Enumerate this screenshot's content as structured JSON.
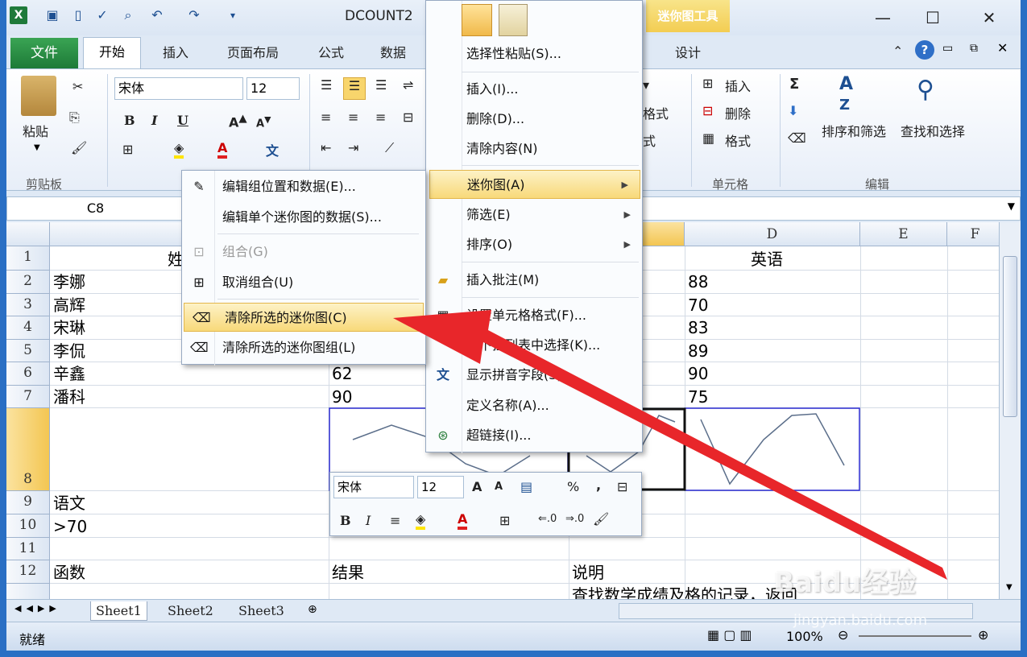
{
  "titlebar": {
    "title": "DCOUNT2",
    "context_tab": "迷你图工具"
  },
  "tabs": {
    "file": "文件",
    "home": "开始",
    "insert": "插入",
    "layout": "页面布局",
    "formula": "公式",
    "data": "数据",
    "design": "设计"
  },
  "ribbon": {
    "paste": "粘贴",
    "clipboard": "剪贴板",
    "font_name": "宋体",
    "font_size": "12",
    "bold": "B",
    "italic": "I",
    "underline": "U",
    "insert": "插入",
    "delete": "删除",
    "format": "格式",
    "cells_group": "单元格",
    "sort_filter": "排序和筛选",
    "find_select": "查找和选择",
    "edit_group": "编辑",
    "partial_format1": "格式",
    "partial_format2": "式"
  },
  "namebox": "C8",
  "columns": {
    "a": "",
    "b": "",
    "c": "",
    "d": "D",
    "e": "E",
    "f": "F"
  },
  "header_row": {
    "b_partial": "姓",
    "d": "英语"
  },
  "rows": [
    {
      "n": "1"
    },
    {
      "n": "2"
    },
    {
      "n": "3"
    },
    {
      "n": "4"
    },
    {
      "n": "5"
    },
    {
      "n": "6"
    },
    {
      "n": "7"
    },
    {
      "n": "8"
    },
    {
      "n": "9"
    },
    {
      "n": "10"
    },
    {
      "n": "11"
    },
    {
      "n": "12"
    }
  ],
  "names": [
    "李娜",
    "高辉",
    "宋琳",
    "李侃",
    "辛鑫",
    "潘科"
  ],
  "english": [
    "88",
    "70",
    "83",
    "89",
    "90",
    "75"
  ],
  "col_b_values": {
    "r6": "62",
    "r7": "90"
  },
  "row9": "语文",
  "row10": ">70",
  "row12": {
    "a": "函数",
    "b": "结果",
    "c": "说明"
  },
  "row13_c": "查找数学成绩及格的记录，返回",
  "sheets": [
    "Sheet1",
    "Sheet2",
    "Sheet3"
  ],
  "status": {
    "ready": "就绪",
    "zoom": "100%"
  },
  "submenu": [
    {
      "label": "编辑组位置和数据(E)...",
      "icon": "edit-sparkline-group-icon",
      "state": "normal"
    },
    {
      "label": "编辑单个迷你图的数据(S)...",
      "icon": "",
      "state": "normal"
    },
    {
      "label": "组合(G)",
      "icon": "group-icon",
      "state": "disabled"
    },
    {
      "label": "取消组合(U)",
      "icon": "ungroup-icon",
      "state": "normal"
    },
    {
      "label": "清除所选的迷你图(C)",
      "icon": "eraser-icon",
      "state": "highlighted"
    },
    {
      "label": "清除所选的迷你图组(L)",
      "icon": "eraser-icon",
      "state": "normal"
    }
  ],
  "context_menu": [
    {
      "label": "选择性粘贴(S)...",
      "arrow": false
    },
    {
      "label": "插入(I)...",
      "arrow": false
    },
    {
      "label": "删除(D)...",
      "arrow": false
    },
    {
      "label": "清除内容(N)",
      "arrow": false
    },
    {
      "label": "迷你图(A)",
      "arrow": true,
      "highlight": true
    },
    {
      "label": "筛选(E)",
      "arrow": true
    },
    {
      "label": "排序(O)",
      "arrow": true
    },
    {
      "label": "插入批注(M)",
      "arrow": false
    },
    {
      "label": "设置单元格格式(F)...",
      "arrow": false
    },
    {
      "label": "从下拉列表中选择(K)...",
      "arrow": false
    },
    {
      "label": "显示拼音字段(S)",
      "arrow": false
    },
    {
      "label": "定义名称(A)...",
      "arrow": false
    },
    {
      "label": "超链接(I)...",
      "arrow": false
    }
  ],
  "minibar": {
    "font": "宋体",
    "size": "12",
    "percent": "%",
    "comma": ","
  },
  "watermark": {
    "brand": "Baidu经验",
    "url": "jingyan.baidu.com"
  },
  "colors": {
    "accent_red": "#e8262a",
    "sparkline_border": "#2a2ad0",
    "selected_col": "#f8d56c"
  }
}
